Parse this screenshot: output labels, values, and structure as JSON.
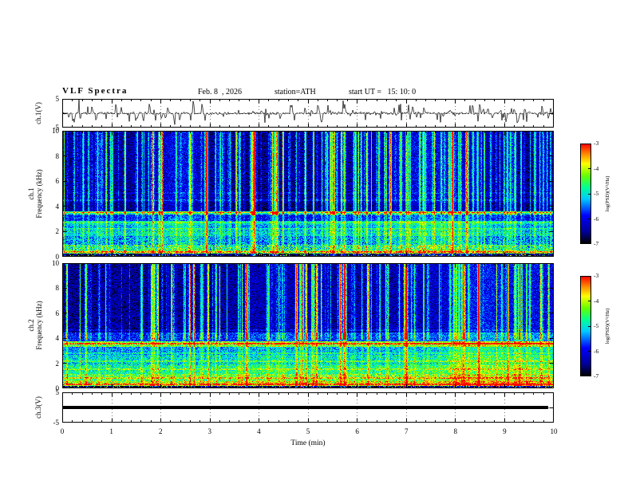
{
  "header": {
    "title": "VLF Spectra",
    "date": "Feb. 8  , 2026",
    "station": "station=ATH",
    "start_ut": "start UT =   15: 10: 0"
  },
  "xaxis": {
    "label": "Time (min)",
    "ticks": [
      "0",
      "1",
      "2",
      "3",
      "4",
      "5",
      "6",
      "7",
      "8",
      "9",
      "10"
    ],
    "range": [
      0,
      10
    ]
  },
  "colorbar": {
    "label": "log(PSD)(V²/Hz)",
    "ticks": [
      "-3",
      "-4",
      "-5",
      "-6",
      "-7"
    ],
    "range": [
      -7,
      -3
    ],
    "colormap": [
      [
        0,
        "#000000"
      ],
      [
        0.12,
        "#000099"
      ],
      [
        0.28,
        "#0000ff"
      ],
      [
        0.45,
        "#00ccff"
      ],
      [
        0.56,
        "#00ff99"
      ],
      [
        0.68,
        "#66ff00"
      ],
      [
        0.8,
        "#ffff00"
      ],
      [
        0.9,
        "#ff8800"
      ],
      [
        1,
        "#ff0000"
      ]
    ]
  },
  "panels": {
    "wave1": {
      "ylabel": "ch.1(V)",
      "yticks": [
        "5",
        "-5"
      ],
      "ytick_marks": [
        5,
        0,
        -5
      ],
      "ylim": [
        -5,
        5
      ]
    },
    "spec1": {
      "ylabel_line1": "ch.1",
      "ylabel_line2": "Frequency (kHz)",
      "yticks": [
        "10",
        "8",
        "6",
        "4",
        "2",
        "0"
      ],
      "ytick_marks": [
        10,
        8,
        6,
        4,
        2,
        0
      ],
      "ylim": [
        0,
        10
      ]
    },
    "spec2": {
      "ylabel_line1": "ch.2",
      "ylabel_line2": "Frequency (kHz)",
      "yticks": [
        "10",
        "8",
        "6",
        "4",
        "2",
        "0"
      ],
      "ytick_marks": [
        10,
        8,
        6,
        4,
        2,
        0
      ],
      "ylim": [
        0,
        10
      ]
    },
    "wave3": {
      "ylabel": "ch.3(V)",
      "yticks": [
        "5",
        "-5"
      ],
      "ytick_marks": [
        5,
        0,
        -5
      ],
      "ylim": [
        -5,
        5
      ]
    }
  },
  "chart_data": [
    {
      "id": "ch1_time_series",
      "type": "line",
      "xlabel": "Time (min)",
      "ylabel": "ch.1(V)",
      "x_range": [
        0,
        10
      ],
      "ylim": [
        -5,
        5
      ],
      "description": "ch.1 raw voltage: noise floor about +/-0.5 V around 0 V with frequent impulsive sferic spikes reaching +/-3 to 4 V over the whole 10 minute record",
      "gen": {
        "seed": 11,
        "noise_amp": 0.38,
        "spike_count": 120,
        "spike_amp": [
          0.5,
          3.2
        ],
        "neg_bias": 0.55
      }
    },
    {
      "id": "ch1_spectrogram",
      "type": "heatmap",
      "xlabel": "Time (min)",
      "ylabel": "ch.1 Frequency (kHz)",
      "z_label": "log(PSD)(V²/Hz)",
      "x_range": [
        0,
        10
      ],
      "y_range": [
        0,
        10
      ],
      "z_range": [
        -7,
        -3
      ],
      "description": "Spectrogram 0-10 kHz: dark-blue background (~-6.5) above 4 kHz crossed by dense vertical sferic streaks (cyan/green, up to ~-4); layered bands below 3.5 kHz near -5; bright narrow line near 3.5 kHz; dark band 3.6-4.3 kHz; near-black strip with colored speckles below 0.25 kHz",
      "gen": {
        "seed": 21,
        "bands": [
          [
            0.0,
            0.22,
            -6.9,
            0.35,
            0.22,
            3.2
          ],
          [
            0.22,
            0.5,
            -4.5,
            0.8,
            0.06,
            1.0
          ],
          [
            0.5,
            0.95,
            -4.95,
            0.8,
            0.04,
            0.9
          ],
          [
            0.95,
            1.6,
            -5.45,
            0.65,
            0,
            0
          ],
          [
            1.6,
            2.05,
            -5.15,
            0.55,
            0,
            0
          ],
          [
            2.05,
            2.5,
            -5.4,
            0.5,
            0,
            0
          ],
          [
            2.5,
            2.85,
            -5.2,
            0.5,
            0,
            0
          ],
          [
            2.85,
            3.35,
            -5.95,
            0.5,
            0,
            0
          ],
          [
            3.35,
            3.62,
            -5.05,
            0.5,
            0,
            0
          ],
          [
            3.62,
            4.3,
            -6.6,
            0.4,
            0,
            0
          ],
          [
            4.3,
            10.01,
            -6.45,
            0.5,
            0,
            0
          ]
        ],
        "hlines": [
          [
            3.5,
            1.05,
            0.06
          ],
          [
            0.33,
            0.8,
            0.06
          ],
          [
            2.2,
            0.45,
            0.05
          ],
          [
            2.7,
            0.4,
            0.05
          ],
          [
            4.5,
            0.35,
            0.05
          ],
          [
            5.05,
            0.25,
            0.05
          ]
        ],
        "streaks": {
          "count": 180,
          "amp": [
            0.35,
            2.3
          ],
          "width": [
            0.5,
            1.6
          ],
          "full_above": 3.3,
          "low_gain": 0.45
        },
        "mods": {
          "count": 9,
          "amp": 0.55
        }
      }
    },
    {
      "id": "ch2_spectrogram",
      "type": "heatmap",
      "xlabel": "Time (min)",
      "ylabel": "ch.2 Frequency (kHz)",
      "z_label": "log(PSD)(V²/Hz)",
      "x_range": [
        0,
        10
      ],
      "y_range": [
        0,
        10
      ],
      "z_range": [
        -7,
        -3
      ],
      "description": "Spectrogram 0-10 kHz: dark-blue background above ~4.5 kHz with vertical sferic streaks; strong green/yellow banded power below 3.5 kHz (~-4 to -5) with bright orange/red horizontal lines near 0.3 and 3.55 kHz; near-black speckled strip below 0.2 kHz",
      "gen": {
        "seed": 77,
        "bands": [
          [
            0.0,
            0.18,
            -6.8,
            0.4,
            0.28,
            3.3
          ],
          [
            0.18,
            0.55,
            -4.0,
            0.75,
            0.08,
            0.8
          ],
          [
            0.55,
            1.15,
            -4.4,
            0.7,
            0.05,
            0.8
          ],
          [
            1.15,
            1.85,
            -4.75,
            0.6,
            0,
            0
          ],
          [
            1.85,
            2.65,
            -5.0,
            0.6,
            0,
            0
          ],
          [
            2.65,
            3.3,
            -5.3,
            0.55,
            0,
            0
          ],
          [
            3.3,
            3.75,
            -4.35,
            0.7,
            0.04,
            0.8
          ],
          [
            3.75,
            4.45,
            -5.75,
            0.5,
            0,
            0
          ],
          [
            4.45,
            10.01,
            -6.4,
            0.5,
            0,
            0
          ]
        ],
        "hlines": [
          [
            3.55,
            1.15,
            0.07
          ],
          [
            0.3,
            0.85,
            0.07
          ],
          [
            0.8,
            0.6,
            0.05
          ],
          [
            1.5,
            0.5,
            0.05
          ],
          [
            2.15,
            0.45,
            0.05
          ],
          [
            2.8,
            0.4,
            0.05
          ],
          [
            4.65,
            0.3,
            0.05
          ]
        ],
        "streaks": {
          "count": 160,
          "amp": [
            0.35,
            2.2
          ],
          "width": [
            0.5,
            1.6
          ],
          "full_above": 3.9,
          "low_gain": 0.35
        },
        "mods": {
          "count": 9,
          "amp": 0.55
        }
      }
    },
    {
      "id": "ch3_time_series",
      "type": "line",
      "xlabel": "Time (min)",
      "ylabel": "ch.3(V)",
      "x_range": [
        0,
        10
      ],
      "ylim": [
        -5,
        5
      ],
      "description": "ch.3 voltage: constant 0 V (flat thick black line) from 0 to ~9.9 min",
      "constant_value": 0,
      "x_end": 9.9,
      "line_thickness_px": 4
    }
  ]
}
